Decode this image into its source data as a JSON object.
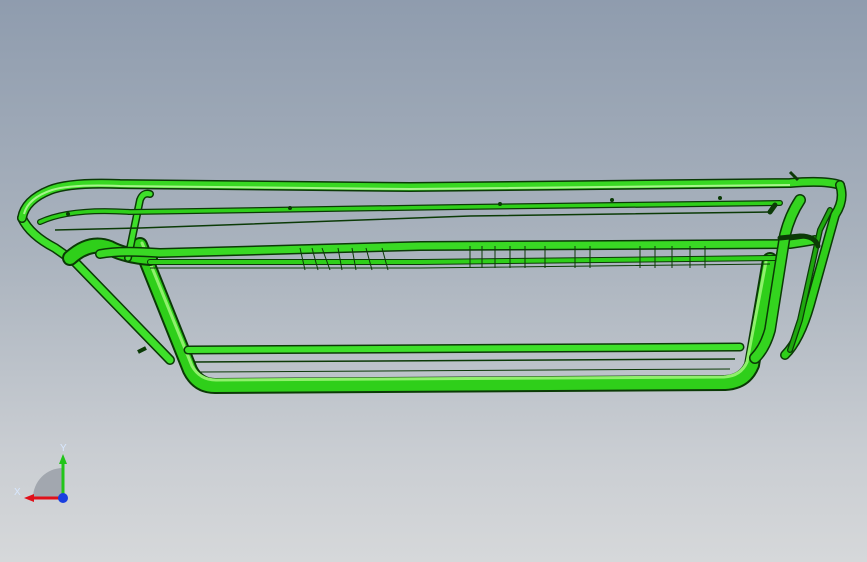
{
  "viewport": {
    "background_top": "#8f9cae",
    "background_bottom": "#d6d8da"
  },
  "model": {
    "part_color": "#2fcf1a",
    "edge_color": "#0b3a06",
    "highlight_color": "#7ff25c"
  },
  "triad": {
    "x_label": "X",
    "y_label": "Y",
    "x_color": "#e0101a",
    "y_color": "#22c51a",
    "z_color": "#1a3fe0"
  }
}
